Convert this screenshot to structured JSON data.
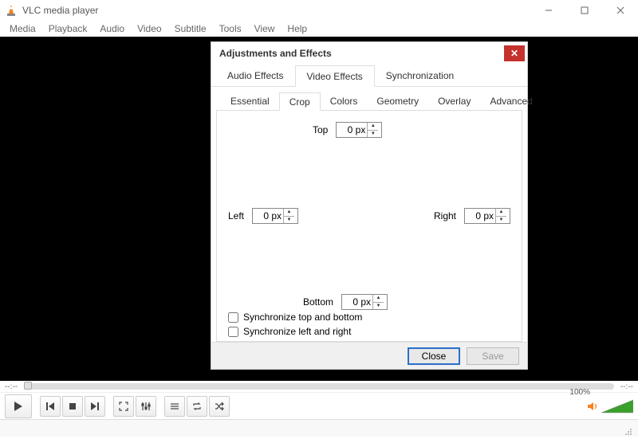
{
  "app": {
    "title": "VLC media player"
  },
  "menu": [
    "Media",
    "Playback",
    "Audio",
    "Video",
    "Subtitle",
    "Tools",
    "View",
    "Help"
  ],
  "dialog": {
    "title": "Adjustments and Effects",
    "mainTabs": [
      "Audio Effects",
      "Video Effects",
      "Synchronization"
    ],
    "mainActive": 1,
    "subTabs": [
      "Essential",
      "Crop",
      "Colors",
      "Geometry",
      "Overlay",
      "Advanced"
    ],
    "subActive": 1,
    "crop": {
      "topLabel": "Top",
      "topValue": "0 px",
      "leftLabel": "Left",
      "leftValue": "0 px",
      "rightLabel": "Right",
      "rightValue": "0 px",
      "bottomLabel": "Bottom",
      "bottomValue": "0 px",
      "syncTB": "Synchronize top and bottom",
      "syncLR": "Synchronize left and right"
    },
    "buttons": {
      "close": "Close",
      "save": "Save"
    }
  },
  "seek": {
    "left": "--:--",
    "right": "--:--"
  },
  "volume": {
    "percent": "100%"
  }
}
